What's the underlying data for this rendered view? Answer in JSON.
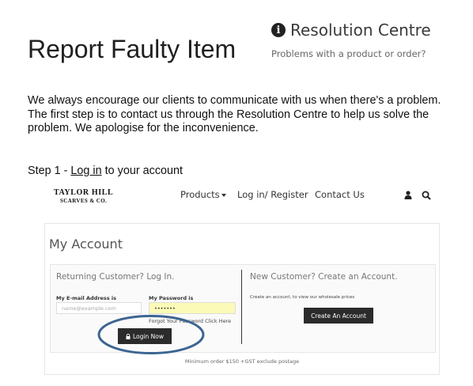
{
  "page": {
    "title": "Report Faulty Item",
    "intro": "We always encourage our clients to communicate with us when there's a problem. The first step is to contact us through the Resolution Centre to help us solve the problem. We apologise for the inconvenience.",
    "step_prefix": "Step 1 - ",
    "step_link": "Log in",
    "step_suffix": " to your account"
  },
  "resolution": {
    "icon": "info-circle-icon",
    "title": "Resolution Centre",
    "subtitle": "Problems with a product or order?"
  },
  "site": {
    "logo_line1": "TAYLOR HILL",
    "logo_line2": "SCARVES & CO.",
    "nav": {
      "products": "Products",
      "login_register": "Log in/ Register",
      "contact": "Contact Us"
    },
    "icons": {
      "user": "user-icon",
      "search": "search-icon"
    },
    "account": {
      "title": "My Account",
      "returning_title": "Returning Customer? Log In.",
      "email_label": "My E-mail Address is",
      "email_placeholder": "name@example.com",
      "password_label": "My Password is",
      "password_value": "•••••••",
      "forgot_text": "Forgot Your Password Click Here",
      "login_button": "Login Now",
      "new_title": "New Customer? Create an Account.",
      "new_desc": "Create an account, to view our wholesale prices",
      "create_button": "Create An Account",
      "min_order": "Minimum order $150 +GST exclude postage"
    }
  },
  "colors": {
    "highlight_ellipse": "#3c6591",
    "button_bg": "#2b2b2b",
    "password_autofill": "#fbfbb7"
  }
}
